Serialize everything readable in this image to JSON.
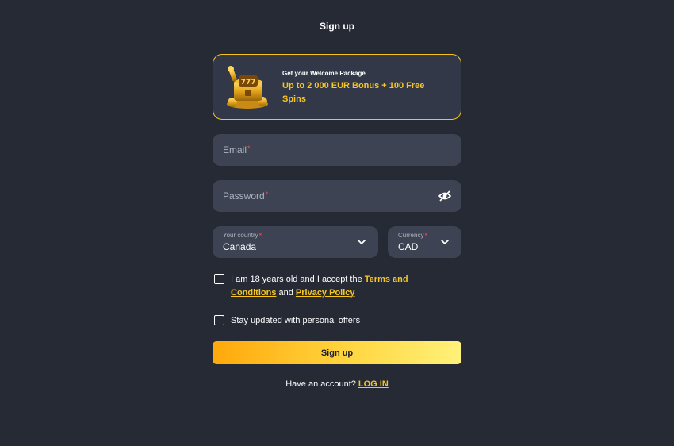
{
  "header": {
    "title": "Sign up"
  },
  "promo": {
    "kicker": "Get your Welcome Package",
    "offer": "Up to 2 000 EUR Bonus + 100 Free Spins",
    "art_icon": "treasure-chest-icon"
  },
  "form": {
    "email": {
      "placeholder": "Email",
      "required_mark": "*"
    },
    "password": {
      "placeholder": "Password",
      "required_mark": "*",
      "toggle_icon": "eye-slash-icon"
    },
    "country": {
      "label": "Your country",
      "required_mark": "*",
      "value": "Canada",
      "icon": "chevron-down-icon"
    },
    "currency": {
      "label": "Currency",
      "required_mark": "*",
      "value": "CAD",
      "icon": "chevron-down-icon"
    },
    "terms": {
      "text_before": "I am 18 years old and I accept the ",
      "terms_link": "Terms and Conditions",
      "text_middle": " and ",
      "privacy_link": "Privacy Policy",
      "checked": false
    },
    "offers": {
      "text": "Stay updated with personal offers",
      "checked": false
    },
    "submit_label": "Sign up"
  },
  "footer": {
    "prompt": "Have an account?",
    "login_link": "LOG IN"
  },
  "colors": {
    "background": "#262a35",
    "field": "#3d4352",
    "accent": "#f7c623",
    "required": "#ff4d4d",
    "button_start": "#ffa80a",
    "button_end": "#fff27a"
  }
}
